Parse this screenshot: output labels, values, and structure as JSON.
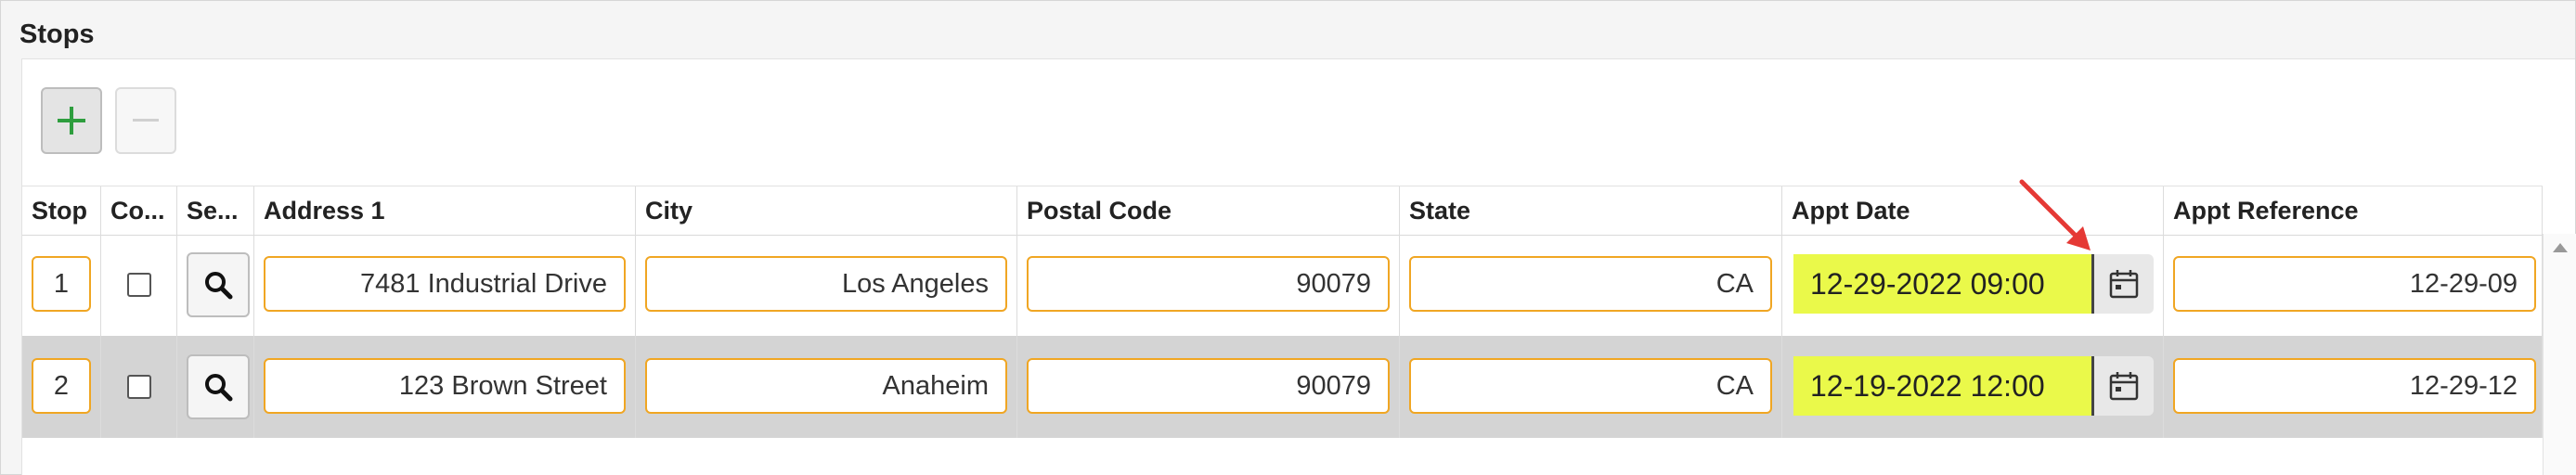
{
  "section": {
    "title": "Stops"
  },
  "toolbar": {
    "add_icon": "plus-icon",
    "remove_icon": "minus-icon"
  },
  "columns": [
    "Stop",
    "Co...",
    "Se...",
    "Address 1",
    "City",
    "Postal Code",
    "State",
    "Appt Date",
    "Appt Reference"
  ],
  "rows": [
    {
      "stop": "1",
      "checked": false,
      "address1": "7481 Industrial Drive",
      "city": "Los Angeles",
      "postal_code": "90079",
      "state": "CA",
      "appt_date": "12-29-2022 09:00",
      "appt_reference": "12-29-09"
    },
    {
      "stop": "2",
      "checked": false,
      "address1": "123 Brown Street",
      "city": "Anaheim",
      "postal_code": "90079",
      "state": "CA",
      "appt_date": "12-19-2022 12:00",
      "appt_reference": "12-29-12"
    }
  ],
  "colors": {
    "field_border": "#f0a623",
    "date_highlight": "#eaf94a",
    "annotation_arrow": "#e53935",
    "plus_green": "#2e9e3e",
    "alt_row": "#d4d4d4"
  }
}
